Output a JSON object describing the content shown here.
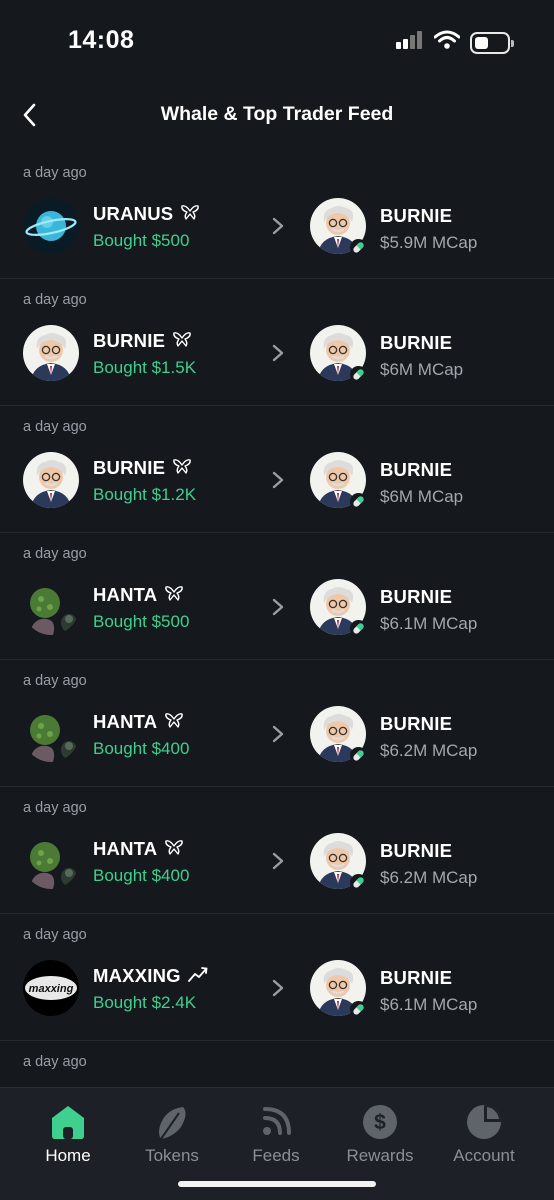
{
  "status_bar": {
    "time": "14:08"
  },
  "header": {
    "title": "Whale & Top Trader Feed"
  },
  "feed": [
    {
      "time_ago": "a day ago",
      "source": "URANUS",
      "source_icon": "whale-ribbon-icon",
      "source_avatar": "planet",
      "action": "Bought $500",
      "token": "BURNIE",
      "mcap": "$5.9M MCap"
    },
    {
      "time_ago": "a day ago",
      "source": "BURNIE",
      "source_icon": "whale-ribbon-icon",
      "source_avatar": "burnie",
      "action": "Bought $1.5K",
      "token": "BURNIE",
      "mcap": "$6M MCap"
    },
    {
      "time_ago": "a day ago",
      "source": "BURNIE",
      "source_icon": "whale-ribbon-icon",
      "source_avatar": "burnie",
      "action": "Bought $1.2K",
      "token": "BURNIE",
      "mcap": "$6M MCap"
    },
    {
      "time_ago": "a day ago",
      "source": "HANTA",
      "source_icon": "whale-ribbon-icon",
      "source_avatar": "virus",
      "action": "Bought $500",
      "token": "BURNIE",
      "mcap": "$6.1M MCap"
    },
    {
      "time_ago": "a day ago",
      "source": "HANTA",
      "source_icon": "whale-ribbon-icon",
      "source_avatar": "virus",
      "action": "Bought $400",
      "token": "BURNIE",
      "mcap": "$6.2M MCap"
    },
    {
      "time_ago": "a day ago",
      "source": "HANTA",
      "source_icon": "whale-ribbon-icon",
      "source_avatar": "virus",
      "action": "Bought $400",
      "token": "BURNIE",
      "mcap": "$6.2M MCap"
    },
    {
      "time_ago": "a day ago",
      "source": "MAXXING",
      "source_icon": "trend-up-icon",
      "source_avatar": "maxxing",
      "source_avatar_text": "maxxing",
      "action": "Bought $2.4K",
      "token": "BURNIE",
      "mcap": "$6.1M MCap"
    },
    {
      "time_ago": "a day ago"
    }
  ],
  "tabs": [
    {
      "label": "Home",
      "icon": "home-icon",
      "active": true
    },
    {
      "label": "Tokens",
      "icon": "tokens-icon"
    },
    {
      "label": "Feeds",
      "icon": "feeds-icon"
    },
    {
      "label": "Rewards",
      "icon": "rewards-icon",
      "icon_text": "$"
    },
    {
      "label": "Account",
      "icon": "account-icon"
    }
  ],
  "colors": {
    "background": "#15181d",
    "accent_green": "#3fcf8e",
    "muted_text": "#a3a7ae"
  }
}
